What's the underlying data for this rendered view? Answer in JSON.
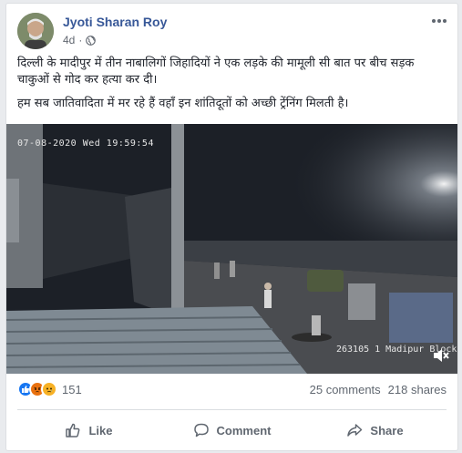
{
  "post": {
    "author": "Jyoti Sharan Roy",
    "time": "4d",
    "paragraph_1": "दिल्ली के मादीपुर में तीन नाबालिगों जिहादियों ने एक लड़के की मामूली सी बात पर बीच सड़क चाकुओं से गोद कर हत्या कर दी।",
    "paragraph_2": "हम सब जातिवादिता में मर रहे हैं वहाँ इन शांतिदूतों को अच्छी ट्रेंनिंग मिलती है।"
  },
  "video": {
    "timestamp": "07-08-2020 Wed 19:59:54",
    "camera_label": "263105 1 Madipur Block"
  },
  "stats": {
    "reaction_count": "151",
    "comments": "25 comments",
    "shares": "218 shares"
  },
  "actions": {
    "like": "Like",
    "comment": "Comment",
    "share": "Share"
  },
  "colors": {
    "author": "#385898",
    "like_reaction": "#1877f2",
    "angry_reaction": "#e9710f",
    "sad_reaction": "#f7b125"
  }
}
